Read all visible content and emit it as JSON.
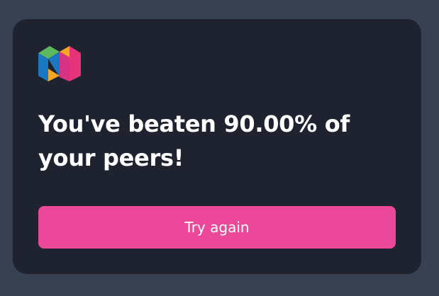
{
  "logo": {
    "icon": "brand-logo-icon",
    "colors": {
      "green": "#5cb85c",
      "pink": "#e6337a",
      "blue": "#1a78c2",
      "orange": "#f5a623",
      "magenta": "#d63384"
    }
  },
  "result": {
    "message": "You've beaten 90.00% of your peers!"
  },
  "actions": {
    "retry_label": "Try again"
  },
  "colors": {
    "page_background": "#374151",
    "card_background": "#1f2330",
    "button_background": "#ec4899",
    "text": "#ffffff"
  }
}
